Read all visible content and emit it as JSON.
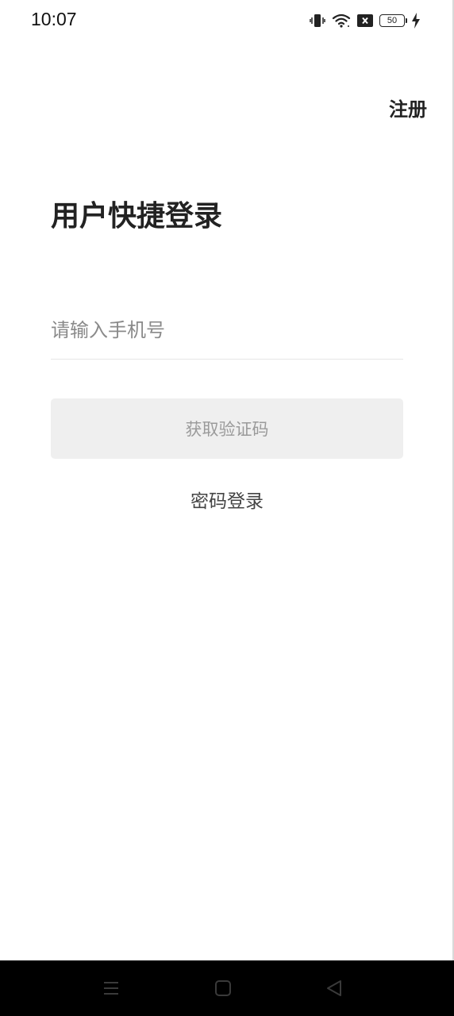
{
  "status_bar": {
    "time": "10:07",
    "battery_level": "50",
    "icons": [
      "vibrate-icon",
      "wifi-icon",
      "no-sim-icon",
      "battery-icon",
      "charging-icon"
    ]
  },
  "header": {
    "register_label": "注册"
  },
  "main": {
    "title": "用户快捷登录",
    "phone_input": {
      "placeholder": "请输入手机号",
      "value": ""
    },
    "get_code_label": "获取验证码",
    "password_login_label": "密码登录"
  },
  "nav_bar": {
    "buttons": [
      "menu-icon",
      "home-icon",
      "back-icon"
    ]
  },
  "colors": {
    "background": "#ffffff",
    "text_primary": "#222222",
    "placeholder": "#8a8a8a",
    "button_disabled_bg": "#efefef",
    "button_disabled_text": "#9a9a9a",
    "nav_bar_bg": "#000000"
  }
}
